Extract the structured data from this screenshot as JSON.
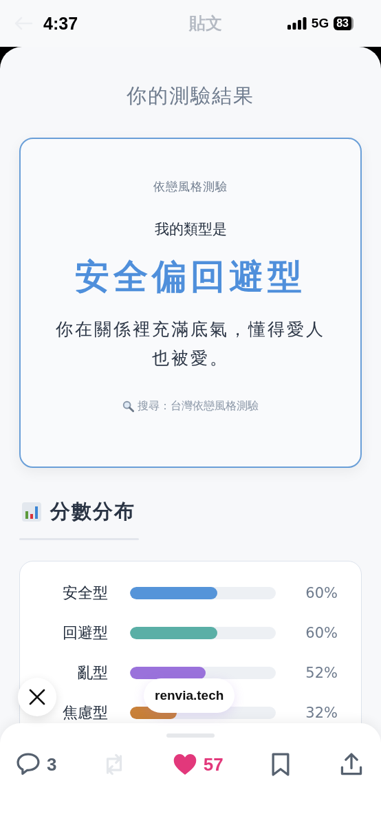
{
  "header": {
    "title": "貼文"
  },
  "status_bar": {
    "time": "4:37",
    "network": "5G",
    "battery": "83"
  },
  "page_title": "你的測驗結果",
  "result_card": {
    "quiz_name": "依戀風格測驗",
    "intro": "我的類型是",
    "result_type": "安全偏回避型",
    "description": "你在關係裡充滿底氣，懂得愛人也被愛。",
    "search_hint": "搜尋：台灣依戀風格測驗"
  },
  "scores": {
    "title": "分數分布",
    "rows": [
      {
        "label": "安全型",
        "level": 0.6,
        "color": "#5594d9",
        "percent": "60%"
      },
      {
        "label": "回避型",
        "level": 0.6,
        "color": "#5aafa6",
        "percent": "60%"
      },
      {
        "label": "亂型",
        "level": 0.52,
        "color": "#9a72db",
        "percent": "52%"
      },
      {
        "label": "焦慮型",
        "level": 0.32,
        "color": "#c98139",
        "percent": "32%"
      }
    ]
  },
  "overlay": {
    "site": "renvia.tech"
  },
  "actions": [
    {
      "kind": "reply",
      "count": "3",
      "disabled": false
    },
    {
      "kind": "repost",
      "disabled": true
    },
    {
      "kind": "like",
      "count": "57",
      "disabled": false,
      "on": true
    },
    {
      "kind": "bookmark",
      "disabled": false
    },
    {
      "kind": "share",
      "disabled": false
    }
  ]
}
